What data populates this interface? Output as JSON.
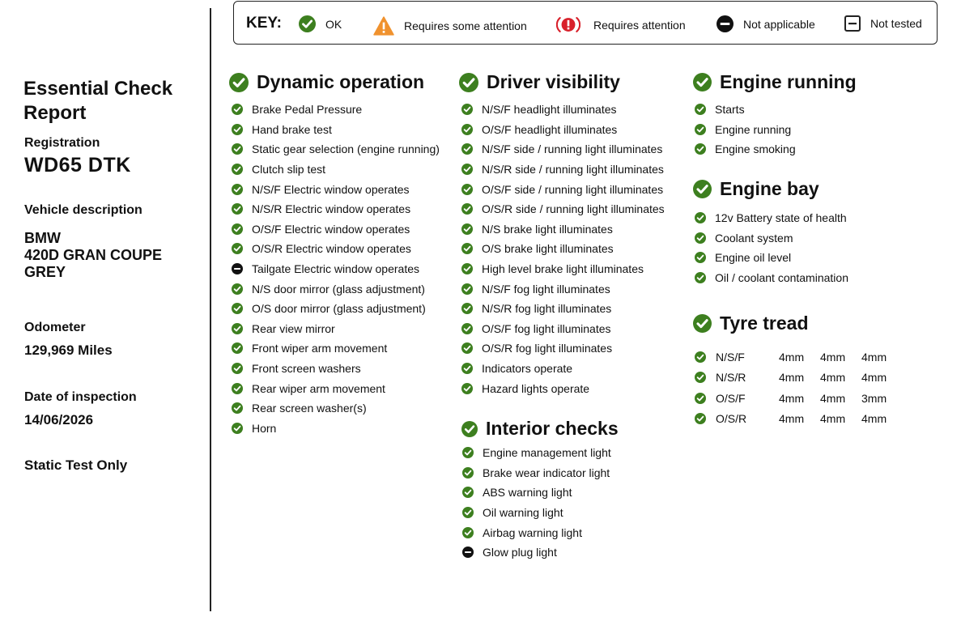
{
  "key": {
    "title": "KEY:",
    "items": [
      {
        "icon": "check-icon",
        "label": "OK"
      },
      {
        "icon": "warning-triangle-icon",
        "label": "Requires some attention"
      },
      {
        "icon": "alert-exclamation-icon",
        "label": "Requires attention"
      },
      {
        "icon": "minus-circle-icon",
        "label": "Not applicable"
      },
      {
        "icon": "minus-square-icon",
        "label": "Not tested"
      }
    ]
  },
  "sidebar": {
    "title": "Essential Check Report",
    "registration_label": "Registration",
    "registration": "WD65 DTK",
    "vehicle_label": "Vehicle description",
    "vehicle_lines": [
      "BMW",
      "420D GRAN COUPE",
      "GREY"
    ],
    "odometer_label": "Odometer",
    "odometer": "129,969 Miles",
    "date_label": "Date of inspection",
    "date": "14/06/2026",
    "note": "Static Test Only"
  },
  "colors": {
    "ok": "#3d7f1f",
    "warning": "#f0922e",
    "attention": "#d8202a",
    "na": "#111111"
  },
  "sections": {
    "dynamic": {
      "title": "Dynamic operation",
      "items": [
        {
          "label": "Brake Pedal Pressure",
          "status": "ok"
        },
        {
          "label": "Hand brake test",
          "status": "ok"
        },
        {
          "label": "Static gear selection (engine running)",
          "status": "ok"
        },
        {
          "label": "Clutch slip test",
          "status": "ok"
        },
        {
          "label": "N/S/F Electric window operates",
          "status": "ok"
        },
        {
          "label": "N/S/R Electric window operates",
          "status": "ok"
        },
        {
          "label": "O/S/F Electric window operates",
          "status": "ok"
        },
        {
          "label": "O/S/R Electric window operates",
          "status": "ok"
        },
        {
          "label": "Tailgate Electric window operates",
          "status": "na"
        },
        {
          "label": "N/S door mirror (glass adjustment)",
          "status": "ok"
        },
        {
          "label": "O/S door mirror (glass adjustment)",
          "status": "ok"
        },
        {
          "label": "Rear view mirror",
          "status": "ok"
        },
        {
          "label": "Front wiper arm movement",
          "status": "ok"
        },
        {
          "label": "Front screen washers",
          "status": "ok"
        },
        {
          "label": "Rear wiper arm movement",
          "status": "ok"
        },
        {
          "label": "Rear screen washer(s)",
          "status": "ok"
        },
        {
          "label": "Horn",
          "status": "ok"
        }
      ]
    },
    "visibility": {
      "title": "Driver visibility",
      "items": [
        {
          "label": "N/S/F headlight illuminates",
          "status": "ok"
        },
        {
          "label": "O/S/F headlight illuminates",
          "status": "ok"
        },
        {
          "label": "N/S/F side / running light illuminates",
          "status": "ok"
        },
        {
          "label": "N/S/R side / running light illuminates",
          "status": "ok"
        },
        {
          "label": "O/S/F side / running light illuminates",
          "status": "ok"
        },
        {
          "label": "O/S/R side / running light illuminates",
          "status": "ok"
        },
        {
          "label": "N/S brake light illuminates",
          "status": "ok"
        },
        {
          "label": "O/S brake light illuminates",
          "status": "ok"
        },
        {
          "label": "High level brake light illuminates",
          "status": "ok"
        },
        {
          "label": "N/S/F fog light illuminates",
          "status": "ok"
        },
        {
          "label": "N/S/R fog light illuminates",
          "status": "ok"
        },
        {
          "label": "O/S/F fog light illuminates",
          "status": "ok"
        },
        {
          "label": "O/S/R fog light illuminates",
          "status": "ok"
        },
        {
          "label": "Indicators operate",
          "status": "ok"
        },
        {
          "label": "Hazard lights operate",
          "status": "ok"
        }
      ]
    },
    "interior": {
      "title": "Interior checks",
      "items": [
        {
          "label": "Engine management light",
          "status": "ok"
        },
        {
          "label": "Brake wear indicator light",
          "status": "ok"
        },
        {
          "label": "ABS warning light",
          "status": "ok"
        },
        {
          "label": "Oil warning light",
          "status": "ok"
        },
        {
          "label": "Airbag warning light",
          "status": "ok"
        },
        {
          "label": "Glow plug light",
          "status": "na"
        }
      ]
    },
    "engine_running": {
      "title": "Engine running",
      "items": [
        {
          "label": "Starts",
          "status": "ok"
        },
        {
          "label": "Engine running",
          "status": "ok"
        },
        {
          "label": "Engine smoking",
          "status": "ok"
        }
      ]
    },
    "engine_bay": {
      "title": "Engine bay",
      "items": [
        {
          "label": "12v Battery state of health",
          "status": "ok"
        },
        {
          "label": "Coolant system",
          "status": "ok"
        },
        {
          "label": "Engine oil level",
          "status": "ok"
        },
        {
          "label": "Oil / coolant contamination",
          "status": "ok"
        }
      ]
    },
    "tyres": {
      "title": "Tyre tread",
      "rows": [
        {
          "position": "N/S/F",
          "readings": [
            "4mm",
            "4mm",
            "4mm"
          ],
          "status": "ok"
        },
        {
          "position": "N/S/R",
          "readings": [
            "4mm",
            "4mm",
            "4mm"
          ],
          "status": "ok"
        },
        {
          "position": "O/S/F",
          "readings": [
            "4mm",
            "4mm",
            "3mm"
          ],
          "status": "ok"
        },
        {
          "position": "O/S/R",
          "readings": [
            "4mm",
            "4mm",
            "4mm"
          ],
          "status": "ok"
        }
      ]
    }
  }
}
